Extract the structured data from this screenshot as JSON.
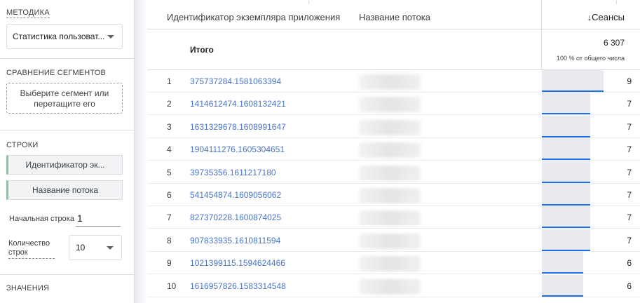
{
  "left_panel": {
    "method": {
      "title": "МЕТОДИКА",
      "value": "Статистика пользоват..."
    },
    "segments": {
      "title": "СРАВНЕНИЕ СЕГМЕНТОВ",
      "dropzone": "Выберите сегмент или перетащите его"
    },
    "rows": {
      "title": "СТРОКИ",
      "dimensions": [
        "Идентификатор эк...",
        "Название потока"
      ],
      "start_row_label": "Начальная строка",
      "start_row_value": "1",
      "row_count_label": "Количество строк",
      "row_count_value": "10"
    },
    "values": {
      "title": "ЗНАЧЕНИЯ"
    }
  },
  "table": {
    "headers": {
      "col1": "Идентификатор экземпляра приложения",
      "col2": "Название потока",
      "metric": "Сеансы",
      "sort_indicator": "↓"
    },
    "totals": {
      "label": "Итого",
      "value": "6 307",
      "percent_text": "100 % от общего числа"
    },
    "rows": [
      {
        "index": "1",
        "id": "375737284.1581063394",
        "value": "9",
        "bar_fraction": 1.0
      },
      {
        "index": "2",
        "id": "1414612474.1608132421",
        "value": "7",
        "bar_fraction": 0.78
      },
      {
        "index": "3",
        "id": "1631329678.1608991647",
        "value": "7",
        "bar_fraction": 0.78
      },
      {
        "index": "4",
        "id": "1904111276.1605304651",
        "value": "7",
        "bar_fraction": 0.78
      },
      {
        "index": "5",
        "id": "39735356.1611217180",
        "value": "7",
        "bar_fraction": 0.78
      },
      {
        "index": "6",
        "id": "541454874.1609056062",
        "value": "7",
        "bar_fraction": 0.78
      },
      {
        "index": "7",
        "id": "827370228.1600874025",
        "value": "7",
        "bar_fraction": 0.78
      },
      {
        "index": "8",
        "id": "907833935.1610811594",
        "value": "7",
        "bar_fraction": 0.78
      },
      {
        "index": "9",
        "id": "1021399115.1594624466",
        "value": "6",
        "bar_fraction": 0.67
      },
      {
        "index": "10",
        "id": "1616957826.1583314548",
        "value": "6",
        "bar_fraction": 0.67
      }
    ]
  },
  "colors": {
    "accent_bar": "#1a73e8",
    "chip_accent": "#81c995",
    "link": "#4a74c9"
  }
}
